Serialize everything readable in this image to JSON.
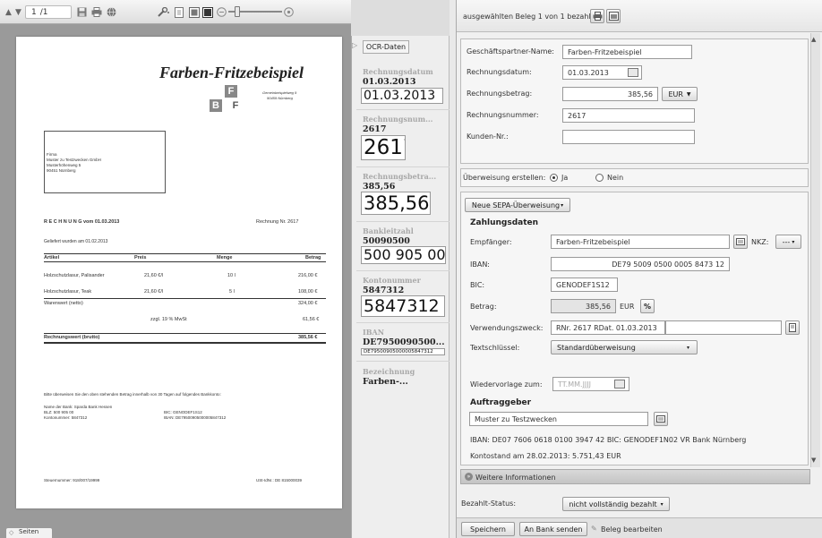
{
  "viewer": {
    "page_field": "1",
    "page_total": "/1",
    "tab_pages": "Seiten",
    "document": {
      "company_name": "Farben-Fritzebeispiel",
      "logo_letter_f": "F",
      "logo_letter_b": "B",
      "logo_letter_f2": "F",
      "tagline_1": "Gemeinbeispielweg 9",
      "tagline_2": "90459 Nürnberg",
      "recipient_line_1": "Firma",
      "recipient_line_2": "Muster zu Testzwecken GmbH",
      "recipient_line_3": "Musterhöhenweg 5",
      "recipient_line_4": "90451 Nürnberg",
      "invoice_title": "R E C H N U N G  vom 01.03.2013",
      "invoice_number": "Rechnung Nr. 2617",
      "delivery_note": "Geliefert wurden am 01.02.2013",
      "table_headers": [
        "Artikel",
        "Preis",
        "Menge",
        "Betrag"
      ],
      "table_rows": [
        [
          "Holzschutzlasur, Palisander",
          "21,60 €/l",
          "10 l",
          "216,00 €"
        ],
        [
          "Holzschutzlasur, Teak",
          "21,60 €/l",
          "5 l",
          "108,00 €"
        ]
      ],
      "net_label": "Warenwert (netto)",
      "net_value": "324,00 €",
      "vat_label": "zzgl. 19 % MwSt",
      "vat_value": "61,56 €",
      "gross_label": "Rechnungswert (brutto)",
      "gross_value": "385,56 €",
      "payment_note": "Bitte überweisen Sie den oben stehenden Betrag innerhalb von 30 Tagen auf folgendes Bankkonto:",
      "bank_name": "Name der Bank: Sparda Bank Hessen",
      "bank_blz": "BLZ: 500 905 00",
      "bank_account": "Kontonummer: 5847312",
      "bank_bic": "BIC: GENODEF1S12",
      "bank_iban": "IBAN: DE79500905000005847312",
      "tax_number": "Steuernummer: 918/007/19999",
      "vat_id": "USt-IdNr.: DE 815000039"
    }
  },
  "ocr": {
    "tab_label": "OCR-Daten",
    "fields": [
      {
        "label": "Rechnungsdatum",
        "value": "01.03.2013",
        "crop": "01.03.2013"
      },
      {
        "label": "Rechnungsnum...",
        "value": "2617",
        "crop": "2617"
      },
      {
        "label": "Rechnungsbetra...",
        "value": "385,56",
        "crop": "385,56"
      },
      {
        "label": "Bankleitzahl",
        "value": "50090500",
        "crop": "500 905 00"
      },
      {
        "label": "Kontonummer",
        "value": "5847312",
        "crop": "5847312"
      },
      {
        "label": "IBAN",
        "value": "DE7950090500...",
        "crop": "DE79500905000005847312"
      },
      {
        "label": "Bezeichnung",
        "value": "Farben-..."
      }
    ]
  },
  "form": {
    "header_text": "ausgewählten Beleg 1 von 1 bezahlen",
    "partner_label": "Geschäftspartner-Name:",
    "partner_value": "Farben-Fritzebeispiel",
    "date_label": "Rechnungsdatum:",
    "date_value": "01.03.2013",
    "amount_label": "Rechnungsbetrag:",
    "amount_value": "385,56",
    "currency": "EUR",
    "number_label": "Rechnungsnummer:",
    "number_value": "2617",
    "customer_label": "Kunden-Nr.:",
    "customer_value": "",
    "transfer_label": "Überweisung erstellen:",
    "radio_yes": "Ja",
    "radio_no": "Nein",
    "new_sepa": "Neue SEPA-Überweisung",
    "zahlungsdaten": "Zahlungsdaten",
    "recipient_label": "Empfänger:",
    "recipient_value": "Farben-Fritzebeispiel",
    "nkz_label": "NKZ:",
    "nkz_value": "---",
    "iban_label": "IBAN:",
    "iban_value": "DE79 5009 0500 0005 8473 12",
    "bic_label": "BIC:",
    "bic_value": "GENODEF1S12",
    "betrag_label": "Betrag:",
    "betrag_value": "385,56",
    "betrag_currency": "EUR",
    "percent": "%",
    "purpose_label": "Verwendungszweck:",
    "purpose_value": "RNr. 2617 RDat. 01.03.2013",
    "purpose_value_2": "",
    "key_label": "Textschlüssel:",
    "key_value": "Standardüberweisung",
    "resubmit_label": "Wiedervorlage zum:",
    "resubmit_placeholder": "TT.MM.JJJJ",
    "auftraggeber": "Auftraggeber",
    "orderer_value": "Muster zu Testzwecken",
    "orderer_iban": "IBAN: DE07 7606 0618 0100 3947 42  BIC:  GENODEF1N02  VR Bank Nürnberg",
    "orderer_balance": "Kontostand am 28.02.2013: 5.751,43  EUR",
    "more_info": "Weitere Informationen",
    "paid_label": "Bezahlt-Status:",
    "paid_value": "nicht vollständig bezahlt",
    "save": "Speichern",
    "send_bank": "An Bank senden",
    "edit": "Beleg bearbeiten"
  }
}
